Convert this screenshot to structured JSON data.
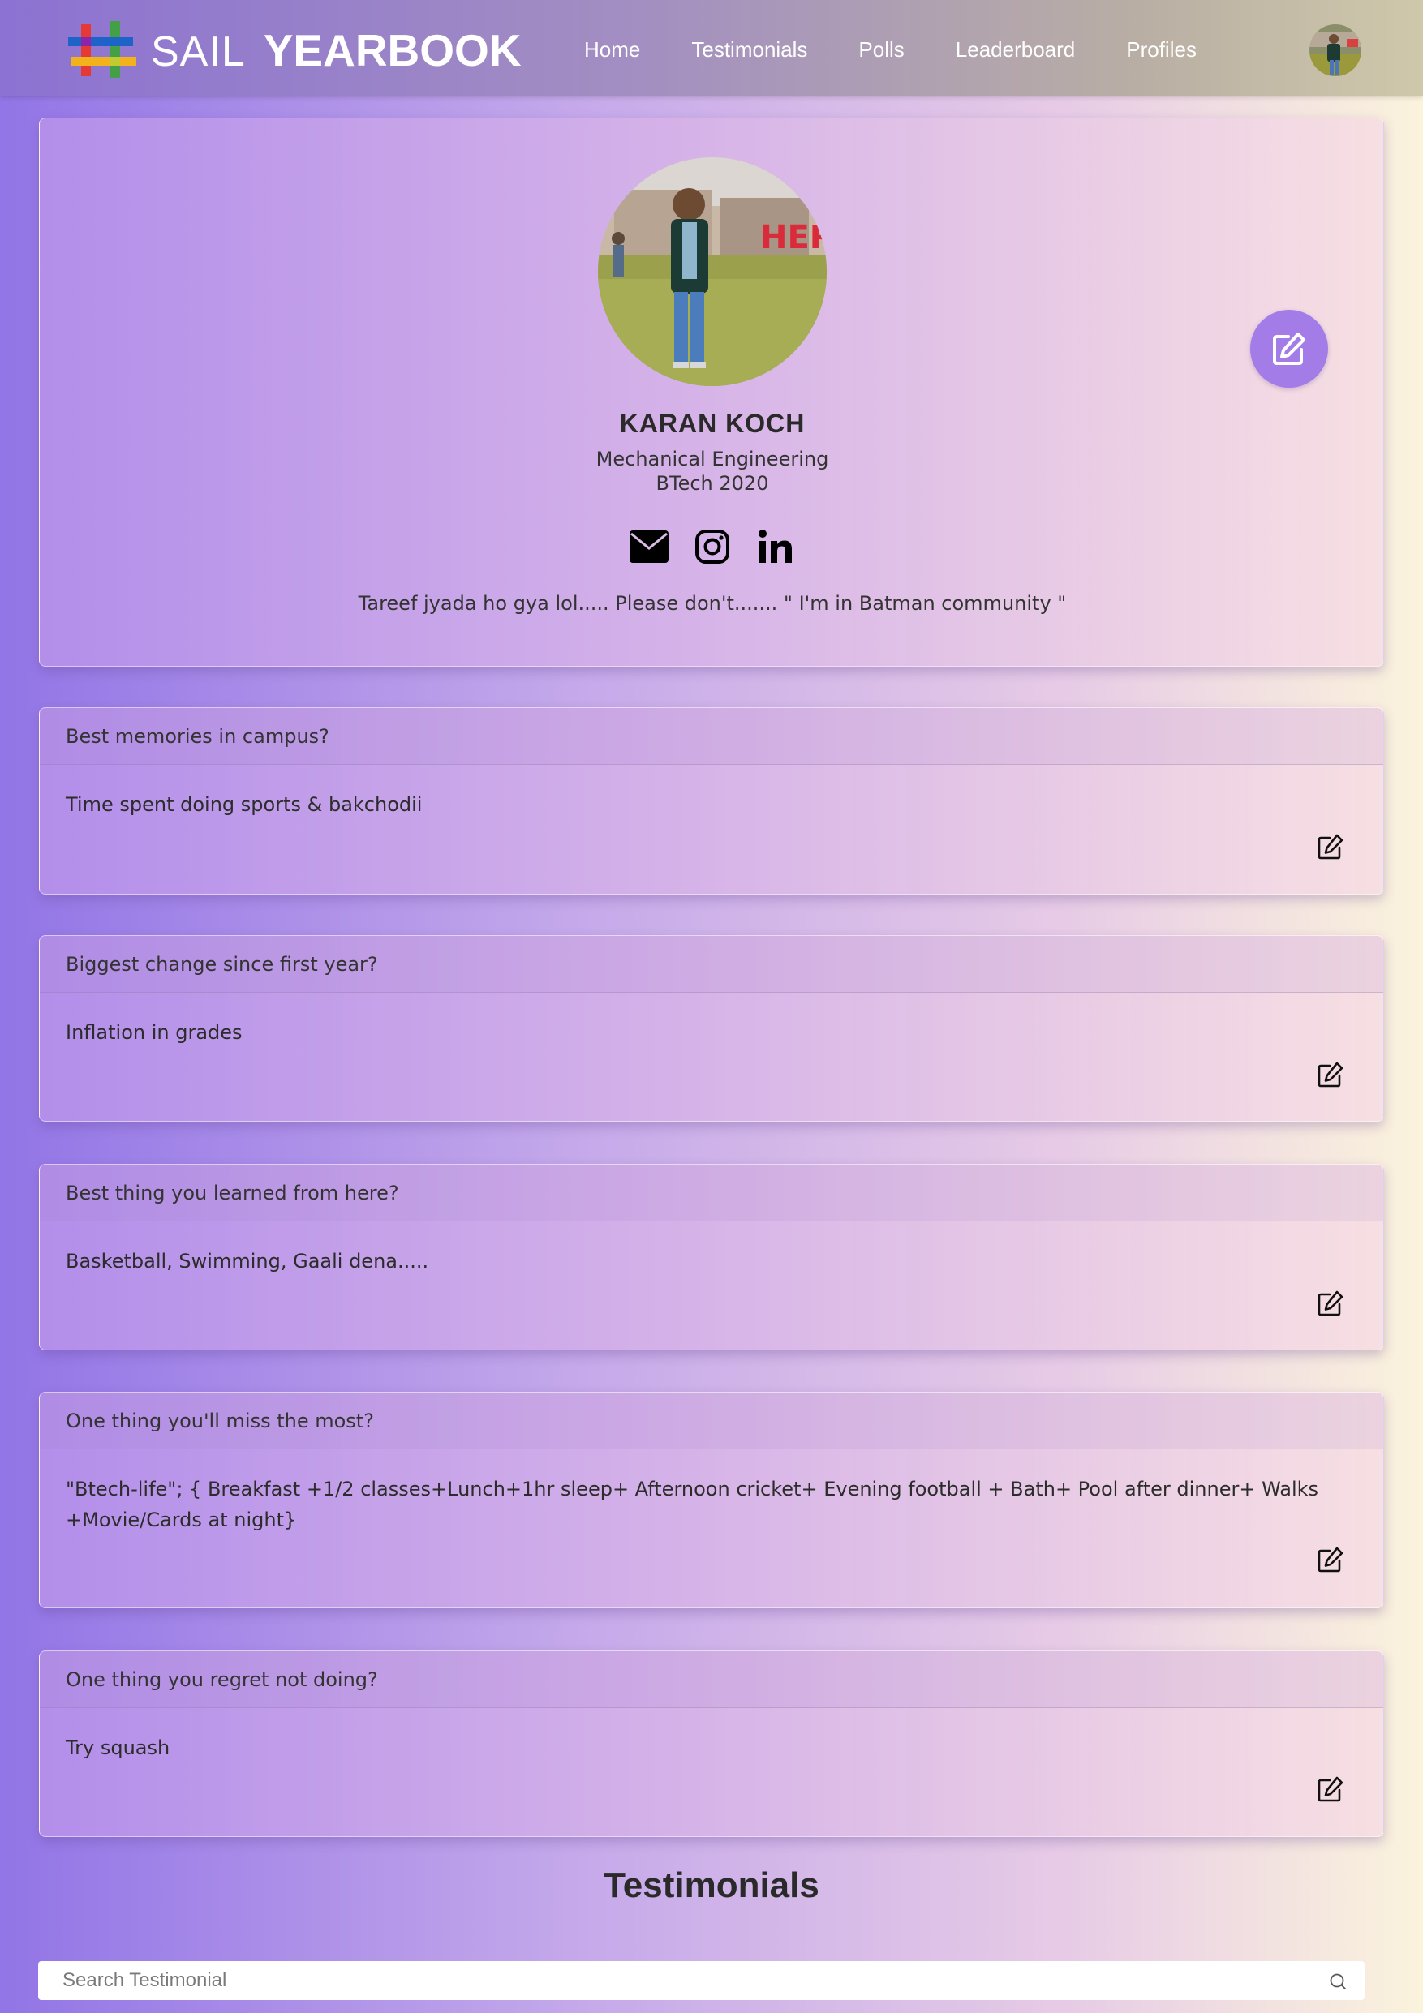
{
  "brand": {
    "part1": "SAIL",
    "part2": "YEARBOOK"
  },
  "nav": {
    "items": [
      {
        "label": "Home"
      },
      {
        "label": "Testimonials"
      },
      {
        "label": "Polls"
      },
      {
        "label": "Leaderboard"
      },
      {
        "label": "Profiles"
      }
    ]
  },
  "profile": {
    "name": "KARAN KOCH",
    "branch": "Mechanical Engineering",
    "batch": "BTech 2020",
    "bio": "Tareef jyada ho gya lol..... Please don't....... \" I'm in Batman community \"",
    "social_icons": [
      "email-icon",
      "instagram-icon",
      "linkedin-icon"
    ]
  },
  "questions": [
    {
      "question": "Best memories in campus?",
      "answer": "Time spent doing sports & bakchodii"
    },
    {
      "question": "Biggest change since first year?",
      "answer": "Inflation in grades"
    },
    {
      "question": "Best thing you learned from here?",
      "answer": "Basketball, Swimming, Gaali dena....."
    },
    {
      "question": "One thing you'll miss the most?",
      "answer": "\"Btech-life\"; { Breakfast +1/2 classes+Lunch+1hr sleep+ Afternoon cricket+ Evening football + Bath+ Pool after dinner+ Walks +Movie/Cards at night}"
    },
    {
      "question": "One thing you regret not doing?",
      "answer": "Try squash"
    }
  ],
  "testimonials": {
    "title": "Testimonials",
    "search_placeholder": "Search Testimonial"
  },
  "colors": {
    "accent": "#a47ce8"
  }
}
